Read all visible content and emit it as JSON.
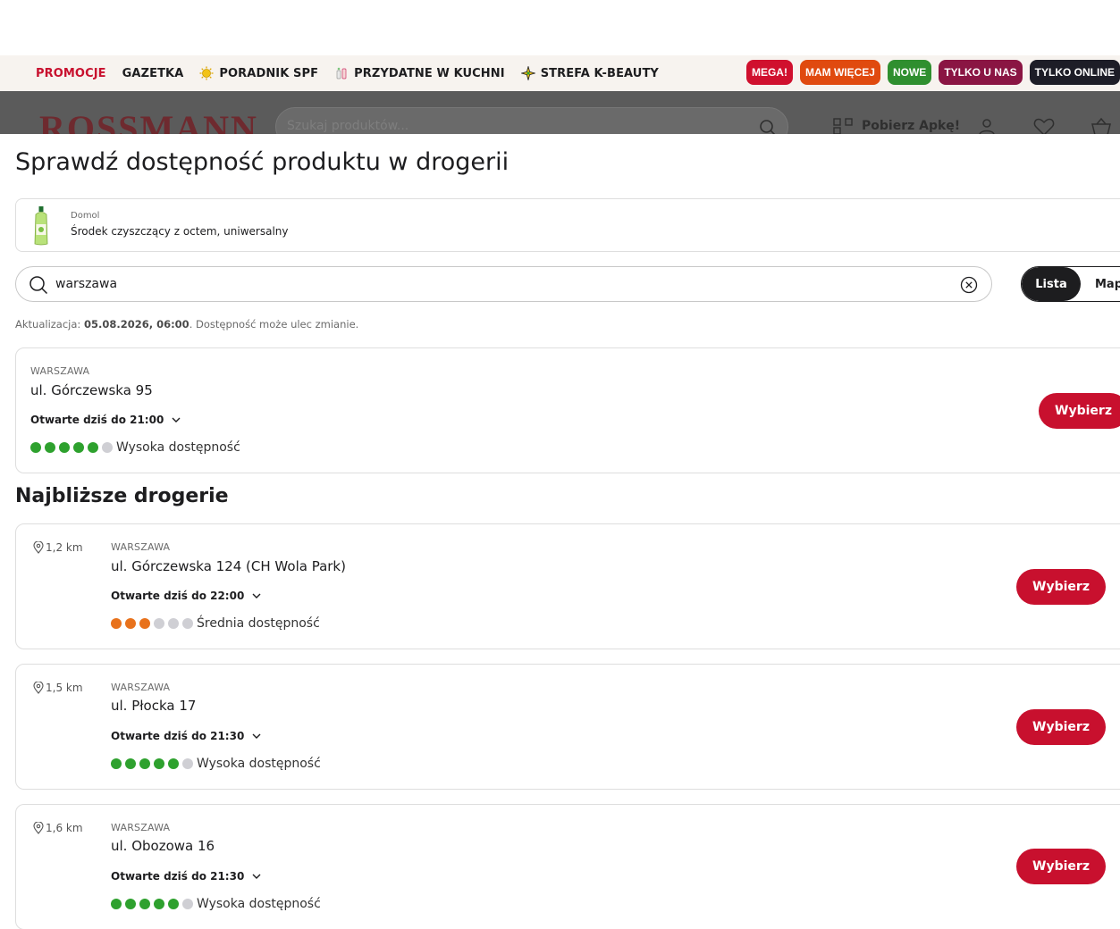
{
  "promo_bar": {
    "links": [
      {
        "label": "PROMOCJE",
        "icon": ""
      },
      {
        "label": "GAZETKA",
        "icon": ""
      },
      {
        "label": "PORADNIK SPF",
        "icon": "sun-icon"
      },
      {
        "label": "PRZYDATNE W KUCHNI",
        "icon": "kitchen-icon"
      },
      {
        "label": "STREFA K-BEAUTY",
        "icon": "sparkle-icon"
      }
    ],
    "badges": [
      {
        "label": "MEGA!",
        "color": "#d0102e"
      },
      {
        "label": "MAM WIĘCEJ",
        "color": "#e04a0f"
      },
      {
        "label": "NOWE",
        "color": "#2f8f2f"
      },
      {
        "label": "TYLKO U NAS",
        "color": "#8a1543"
      },
      {
        "label": "TYLKO ONLINE",
        "color": "#1d1d27"
      }
    ]
  },
  "header": {
    "logo": "ROSSMANN",
    "search_placeholder": "Szukaj produktów...",
    "app_label": "Pobierz Apkę!"
  },
  "modal": {
    "title": "Sprawdź dostępność produktu w drogerii",
    "product": {
      "brand": "Domol",
      "name": "Środek czyszczący z octem, uniwersalny"
    },
    "search_value": "warszawa",
    "view_toggle": {
      "list": "Lista",
      "map": "Map"
    },
    "update": {
      "prefix": "Aktualizacja: ",
      "datetime": "05.08.2026, 06:00",
      "suffix": ". Dostępność może ulec zmianie."
    },
    "selected_store": {
      "city": "WARSZAWA",
      "address": "ul. Górczewska 95",
      "hours": "Otwarte dziś do 21:00",
      "availability_level": 5,
      "availability_max": 6,
      "availability_label": "Wysoka dostępność",
      "button": "Wybierz"
    },
    "nearest_title": "Najbliższe drogerie",
    "stores": [
      {
        "distance": "1,2 km",
        "city": "WARSZAWA",
        "address": "ul. Górczewska 124 (CH Wola Park)",
        "hours": "Otwarte dziś do 22:00",
        "availability_level": 3,
        "availability_max": 6,
        "availability_color": "#e8721c",
        "availability_label": "Średnia dostępność",
        "button": "Wybierz"
      },
      {
        "distance": "1,5 km",
        "city": "WARSZAWA",
        "address": "ul. Płocka 17",
        "hours": "Otwarte dziś do 21:30",
        "availability_level": 5,
        "availability_max": 6,
        "availability_color": "#2ea12e",
        "availability_label": "Wysoka dostępność",
        "button": "Wybierz"
      },
      {
        "distance": "1,6 km",
        "city": "WARSZAWA",
        "address": "ul. Obozowa 16",
        "hours": "Otwarte dziś do 21:30",
        "availability_level": 5,
        "availability_max": 6,
        "availability_color": "#2ea12e",
        "availability_label": "Wysoka dostępność",
        "button": "Wybierz"
      }
    ]
  }
}
